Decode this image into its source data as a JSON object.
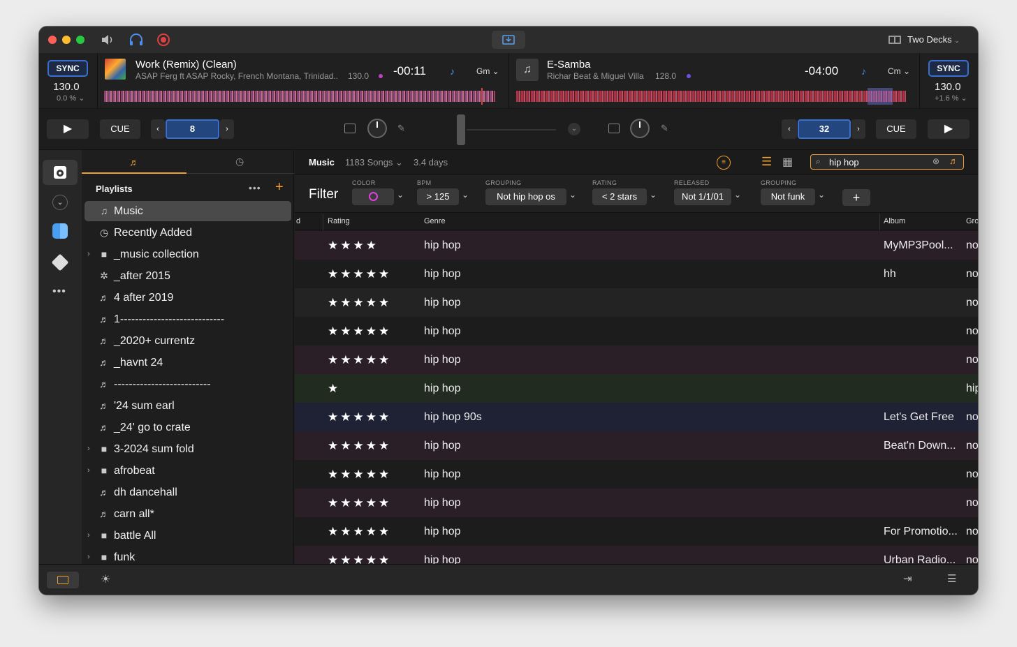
{
  "colors": {
    "accent": "#f0a030",
    "sync": "#3a6fd0",
    "record": "#e04040"
  },
  "topbar": {
    "layout_label": "Two Decks"
  },
  "deck_left": {
    "sync": "SYNC",
    "bpm": "130.0",
    "pitch": "0.0 %",
    "title": "Work (Remix) (Clean)",
    "artist": "ASAP Ferg ft ASAP Rocky, French Montana, Trinidad...",
    "track_bpm": "130.0",
    "time": "-00:11",
    "key": "Gm",
    "loop": "8",
    "cue": "CUE"
  },
  "deck_right": {
    "sync": "SYNC",
    "bpm": "130.0",
    "pitch": "+1.6 %",
    "title": "E-Samba",
    "artist": "Richar Beat & Miguel Villa",
    "track_bpm": "128.0",
    "time": "-04:00",
    "key": "Cm",
    "loop": "32",
    "cue": "CUE"
  },
  "sidebar": {
    "title": "Playlists",
    "items": [
      {
        "label": "Music",
        "icon": "music-icon",
        "chev": false
      },
      {
        "label": "Recently Added",
        "icon": "clock-icon",
        "chev": false
      },
      {
        "label": "_music collection",
        "icon": "folder-icon",
        "chev": true
      },
      {
        "label": "_after 2015",
        "icon": "gear-icon",
        "chev": false
      },
      {
        "label": "4 after 2019",
        "icon": "playlist-icon",
        "chev": false
      },
      {
        "label": "1----------------------------",
        "icon": "playlist-icon",
        "chev": false
      },
      {
        "label": "_2020+ currentz",
        "icon": "playlist-icon",
        "chev": false
      },
      {
        "label": "_havnt 24",
        "icon": "playlist-icon",
        "chev": false
      },
      {
        "label": "--------------------------",
        "icon": "playlist-icon",
        "chev": false
      },
      {
        "label": "'24 sum earl",
        "icon": "playlist-icon",
        "chev": false
      },
      {
        "label": "_24'  go to crate",
        "icon": "playlist-icon",
        "chev": false
      },
      {
        "label": "3-2024 sum fold",
        "icon": "folder-icon",
        "chev": true
      },
      {
        "label": "afrobeat",
        "icon": "folder-icon",
        "chev": true
      },
      {
        "label": "dh dancehall",
        "icon": "playlist-icon",
        "chev": false
      },
      {
        "label": "carn all*",
        "icon": "playlist-icon",
        "chev": false
      },
      {
        "label": "battle All",
        "icon": "folder-icon",
        "chev": true
      },
      {
        "label": "funk",
        "icon": "folder-icon",
        "chev": true
      }
    ]
  },
  "library": {
    "title": "Music",
    "count": "1183 Songs",
    "duration": "3.4 days",
    "search": "hip hop"
  },
  "filter": {
    "label": "Filter",
    "fields": [
      {
        "label": "COLOR",
        "value": ""
      },
      {
        "label": "BPM",
        "value": "> 125"
      },
      {
        "label": "GROUPING",
        "value": "Not hip hop os"
      },
      {
        "label": "RATING",
        "value": "< 2 stars"
      },
      {
        "label": "RELEASED",
        "value": "Not 1/1/01"
      },
      {
        "label": "GROUPING",
        "value": "Not funk"
      }
    ]
  },
  "table": {
    "columns": [
      "d",
      "Rating",
      "Genre",
      "Album",
      "Gro"
    ],
    "rows": [
      {
        "rating": 4,
        "genre": "hip hop",
        "album": "MyMP3Pool...",
        "group": "no",
        "bg": "#2a1f27"
      },
      {
        "rating": 5,
        "genre": "hip hop",
        "album": "hh",
        "group": "no",
        "bg": "#1c1c1c"
      },
      {
        "rating": 5,
        "genre": "hip hop",
        "album": "",
        "group": "no",
        "bg": "#232323"
      },
      {
        "rating": 5,
        "genre": "hip hop",
        "album": "",
        "group": "no",
        "bg": "#1c1c1c"
      },
      {
        "rating": 5,
        "genre": "hip hop",
        "album": "",
        "group": "no",
        "bg": "#2a1f27"
      },
      {
        "rating": 1,
        "genre": "hip hop",
        "album": "",
        "group": "hip",
        "bg": "#222b1f"
      },
      {
        "rating": 5,
        "genre": "hip hop 90s",
        "album": "Let's Get Free",
        "group": "no",
        "bg": "#1f2135"
      },
      {
        "rating": 5,
        "genre": "hip hop",
        "album": "Beat'n Down...",
        "group": "no",
        "bg": "#2a1f27"
      },
      {
        "rating": 5,
        "genre": "hip hop",
        "album": "",
        "group": "no",
        "bg": "#1c1c1c"
      },
      {
        "rating": 5,
        "genre": "hip hop",
        "album": "",
        "group": "no",
        "bg": "#2a1f27"
      },
      {
        "rating": 5,
        "genre": "hip hop",
        "album": "For Promotio...",
        "group": "no",
        "bg": "#1c1c1c"
      },
      {
        "rating": 5,
        "genre": "hip hop",
        "album": "Urban Radio...",
        "group": "no",
        "bg": "#2a1f27"
      }
    ]
  }
}
